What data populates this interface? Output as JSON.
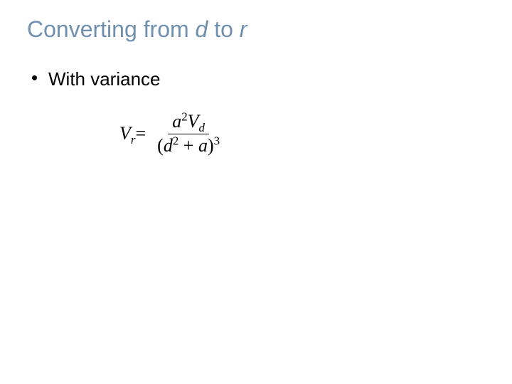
{
  "title": {
    "prefix": "Converting from ",
    "var1": "d",
    "mid": " to ",
    "var2": "r"
  },
  "bullet": {
    "text": "With variance"
  },
  "formula": {
    "lhs_var": "V",
    "lhs_sub": "r",
    "equals": " = ",
    "num_a": "a",
    "num_a_exp": "2",
    "num_V": "V",
    "num_V_sub": "d",
    "den_open": "(",
    "den_d": "d",
    "den_d_exp": "2",
    "den_plus": " + ",
    "den_a": "a",
    "den_close": ")",
    "den_outer_exp": "3"
  }
}
